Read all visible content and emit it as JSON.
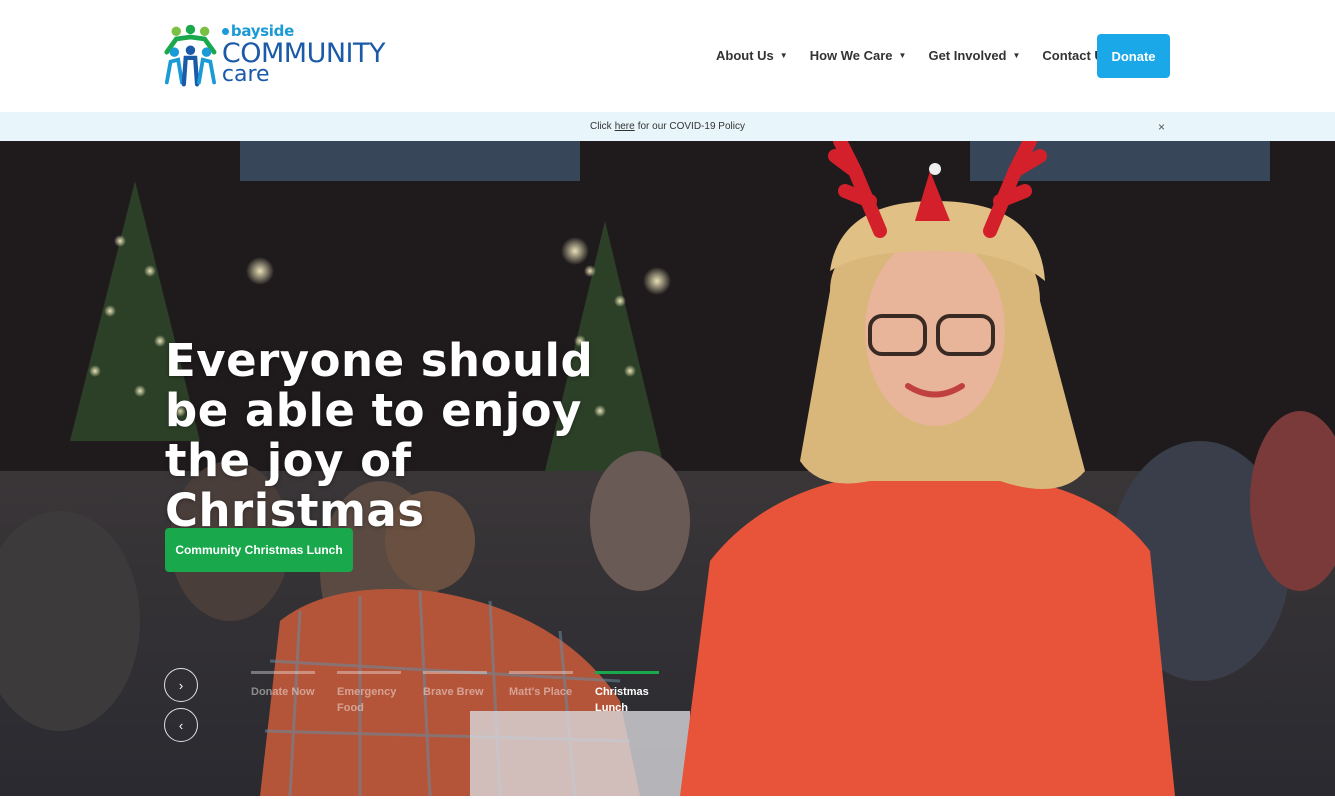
{
  "header": {
    "logo": {
      "small": "bayside",
      "big": "COMMUNITY",
      "care": "care"
    },
    "nav": [
      {
        "label": "About Us"
      },
      {
        "label": "How We Care"
      },
      {
        "label": "Get Involved"
      },
      {
        "label": "Contact Us"
      }
    ],
    "donate_label": "Donate"
  },
  "notice": {
    "prefix": "Click",
    "link": "here",
    "suffix": "for our COVID-19 Policy",
    "close": "×"
  },
  "hero": {
    "title": "Everyone should be able to enjoy the joy of Christmas",
    "cta_label": "Community Christmas Lunch",
    "next_arrow": "›",
    "prev_arrow": "‹",
    "tabs": [
      {
        "label": "Donate Now"
      },
      {
        "label": "Emergency Food"
      },
      {
        "label": "Brave Brew"
      },
      {
        "label": "Matt's Place"
      },
      {
        "label": "Christmas Lunch"
      }
    ],
    "active_tab": 4
  },
  "colors": {
    "brand_blue": "#1b5aa8",
    "donate_blue": "#1aa8e8",
    "cta_green": "#1aa84c",
    "notice_bg": "#e8f5fb"
  }
}
